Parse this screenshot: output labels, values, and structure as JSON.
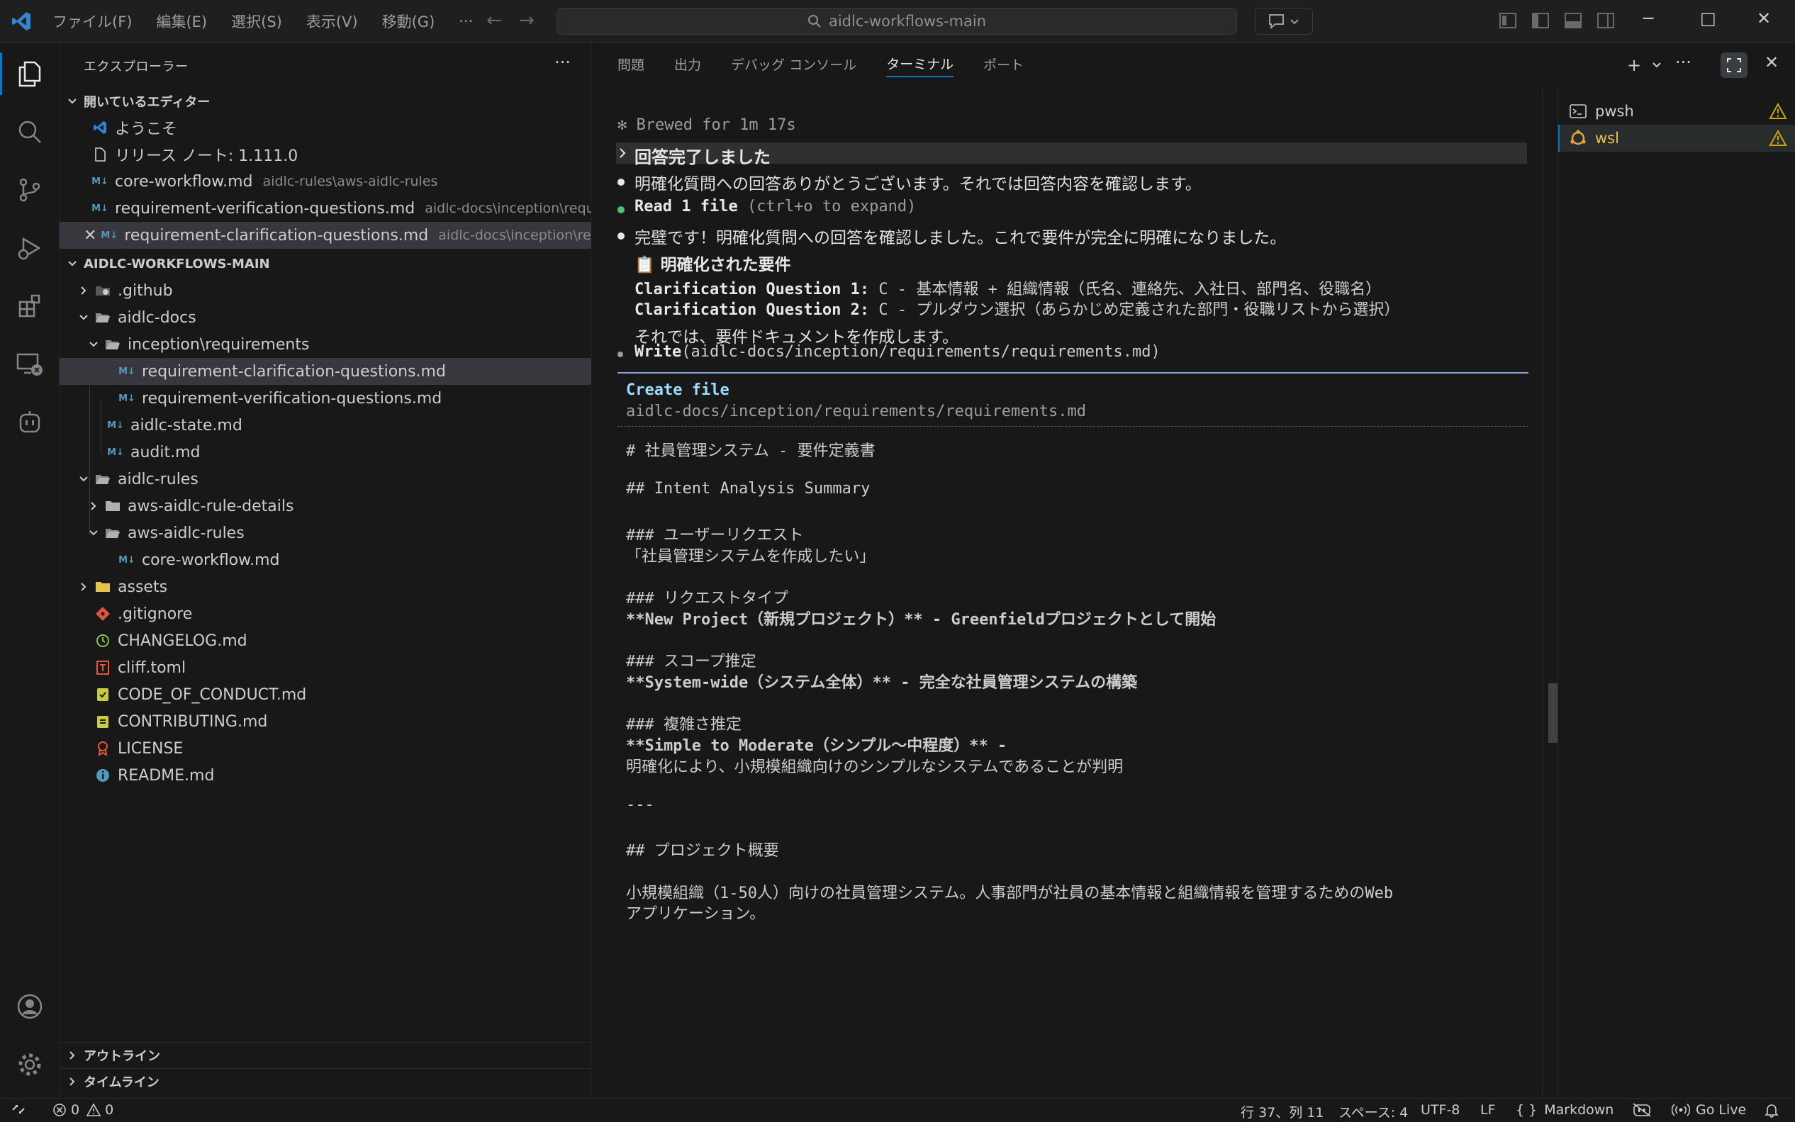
{
  "titlebar": {
    "menu": [
      "ファイル(F)",
      "編集(E)",
      "選択(S)",
      "表示(V)",
      "移動(G)"
    ],
    "more": "···",
    "search": "aidlc-workflows-main"
  },
  "activity": [
    "explorer-icon",
    "search-icon",
    "source-control-icon",
    "run-debug-icon",
    "extensions-icon",
    "remote-explorer-icon",
    "copilot-icon",
    "account-icon",
    "settings-gear-icon"
  ],
  "sidebar": {
    "title": "エクスプローラー",
    "more": "···",
    "open_editors_title": "開いているエディター",
    "open_editors": [
      {
        "name": "ようこそ",
        "desc": ""
      },
      {
        "name": "リリース ノート: 1.111.0",
        "desc": ""
      },
      {
        "name": "core-workflow.md",
        "desc": "aidlc-rules\\aws-aidlc-rules"
      },
      {
        "name": "requirement-verification-questions.md",
        "desc": "aidlc-docs\\inception\\requir..."
      },
      {
        "name": "requirement-clarification-questions.md",
        "desc": "aidlc-docs\\inception\\requi..."
      }
    ],
    "workspace_title": "AIDLC-WORKFLOWS-MAIN",
    "tree": [
      {
        "name": ".github"
      },
      {
        "name": "aidlc-docs"
      },
      {
        "name": "inception\\requirements"
      },
      {
        "name": "requirement-clarification-questions.md"
      },
      {
        "name": "requirement-verification-questions.md"
      },
      {
        "name": "aidlc-state.md"
      },
      {
        "name": "audit.md"
      },
      {
        "name": "aidlc-rules"
      },
      {
        "name": "aws-aidlc-rule-details"
      },
      {
        "name": "aws-aidlc-rules"
      },
      {
        "name": "core-workflow.md"
      },
      {
        "name": "assets"
      },
      {
        "name": ".gitignore"
      },
      {
        "name": "CHANGELOG.md"
      },
      {
        "name": "cliff.toml"
      },
      {
        "name": "CODE_OF_CONDUCT.md"
      },
      {
        "name": "CONTRIBUTING.md"
      },
      {
        "name": "LICENSE"
      },
      {
        "name": "README.md"
      }
    ],
    "outline": "アウトライン",
    "timeline": "タイムライン",
    "md_glyph": "M↓"
  },
  "panel": {
    "tabs": [
      "問題",
      "出力",
      "デバッグ コンソール",
      "ターミナル",
      "ポート"
    ],
    "active_tab": "ターミナル"
  },
  "terminal": {
    "brewed": "✻ Brewed for 1m 17s",
    "collapsed": "回答完了しました",
    "line1": "明確化質問への回答ありがとうございます。それでは回答内容を確認します。",
    "read_label": "Read 1 file",
    "read_hint": "(ctrl+o to expand)",
    "line2": "完璧です！明確化質問への回答を確認しました。これで要件が完全に明確になりました。",
    "heading": "📋 明確化された要件",
    "q1_label": "Clarification Question 1:",
    "q1_value": "C - 基本情報 + 組織情報（氏名、連絡先、入社日、部門名、役職名）",
    "q2_label": "Clarification Question 2:",
    "q2_value": "C - プルダウン選択（あらかじめ定義された部門・役職リストから選択）",
    "line3": "それでは、要件ドキュメントを作成します。",
    "write_label": "Write",
    "write_arg": "(aidlc-docs/inception/requirements/requirements.md)",
    "create_title": "Create file",
    "create_path": "aidlc-docs/inception/requirements/requirements.md",
    "doc": [
      "# 社員管理システム - 要件定義書",
      "",
      "## Intent Analysis Summary",
      "",
      "### ユーザーリクエスト",
      "「社員管理システムを作成したい」",
      "",
      "### リクエストタイプ",
      "**New Project（新規プロジェクト）** - Greenfieldプロジェクトとして開始",
      "",
      "### スコープ推定",
      "**System-wide（システム全体）** - 完全な社員管理システムの構築",
      "",
      "### 複雑さ推定",
      "**Simple to Moderate（シンプル〜中程度）** -",
      "明確化により、小規模組織向けのシンプルなシステムであることが判明",
      "",
      "---",
      "",
      "## プロジェクト概要",
      "",
      "小規模組織（1-50人）向けの社員管理システム。人事部門が社員の基本情報と組織情報を管理するためのWeb",
      "アプリケーション。"
    ]
  },
  "terminal_list": [
    {
      "name": "pwsh"
    },
    {
      "name": "wsl"
    }
  ],
  "statusbar": {
    "errors": "0",
    "warnings": "0",
    "position": "行 37、列 11",
    "spaces": "スペース: 4",
    "encoding": "UTF-8",
    "eol": "LF",
    "language": "Markdown",
    "golive": "Go Live"
  }
}
